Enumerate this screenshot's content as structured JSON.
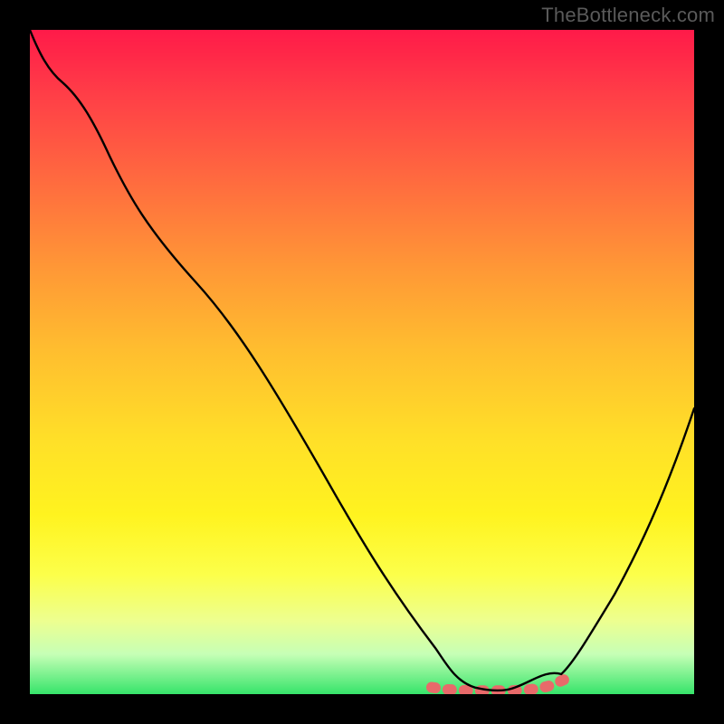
{
  "watermark": "TheBottleneck.com",
  "chart_data": {
    "type": "line",
    "title": "",
    "xlabel": "",
    "ylabel": "",
    "xlim": [
      0,
      100
    ],
    "ylim": [
      0,
      100
    ],
    "grid": false,
    "legend": false,
    "annotations": [],
    "background_gradient": {
      "orientation": "vertical",
      "stops": [
        {
          "pos": 0.0,
          "color": "#ff1a49"
        },
        {
          "pos": 0.24,
          "color": "#ff6f3e"
        },
        {
          "pos": 0.48,
          "color": "#ffbd2f"
        },
        {
          "pos": 0.73,
          "color": "#fff31f"
        },
        {
          "pos": 0.89,
          "color": "#edff90"
        },
        {
          "pos": 1.0,
          "color": "#36e46a"
        }
      ]
    },
    "series": [
      {
        "name": "bottleneck-curve",
        "color": "#000000",
        "x": [
          0.0,
          2.0,
          5.0,
          8.0,
          12.0,
          18.0,
          25.0,
          32.0,
          39.0,
          46.0,
          52.0,
          57.0,
          61.0,
          64.0,
          67.0,
          70.0,
          73.0,
          76.0,
          80.0,
          84.0,
          88.0,
          92.0,
          96.0,
          100.0
        ],
        "y": [
          100.0,
          96.0,
          92.0,
          87.0,
          81.0,
          72.0,
          62.0,
          51.0,
          41.0,
          30.0,
          21.0,
          13.0,
          7.0,
          3.0,
          1.0,
          0.5,
          0.5,
          1.0,
          3.0,
          8.0,
          15.0,
          24.0,
          33.0,
          43.0
        ]
      },
      {
        "name": "optimal-range-markers",
        "color": "#e86a6a",
        "style": "dotted-thick",
        "x": [
          60.5,
          62.5,
          64.5,
          66.5,
          68.5,
          70.5,
          72.5,
          74.5,
          76.5,
          78.5,
          80.5
        ],
        "y": [
          1.0,
          0.7,
          0.6,
          0.5,
          0.5,
          0.5,
          0.5,
          0.6,
          0.8,
          1.3,
          2.2
        ]
      }
    ]
  }
}
